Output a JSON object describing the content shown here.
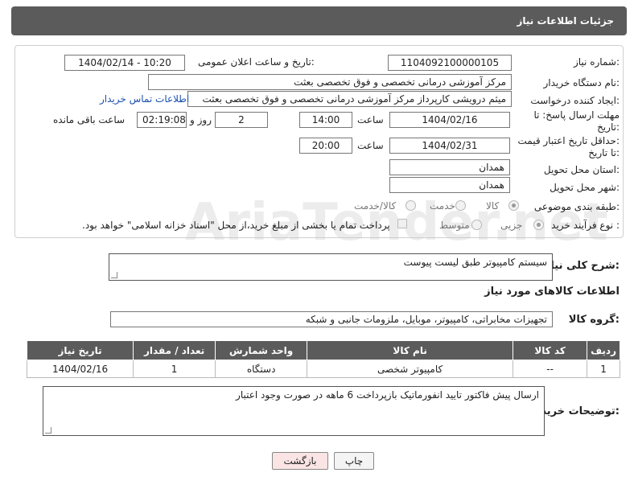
{
  "header": {
    "title": "جزئیات اطلاعات نیاز"
  },
  "fields": {
    "need_number_label": "شماره نیاز:",
    "need_number": "1104092100000105",
    "announce_label": "تاریخ و ساعت اعلان عمومی:",
    "announce_value": "1404/02/14 - 10:20",
    "buyer_org_label": "نام دستگاه خریدار:",
    "buyer_org": "مرکز آموزشی درمانی تخصصی و فوق تخصصی بعثت",
    "creator_label": "ایجاد کننده درخواست:",
    "creator": "میثم درویشی کارپرداز مرکز آموزشی درمانی تخصصی و فوق تخصصی بعثت",
    "contact_link": "اطلاعات تماس خریدار",
    "deadline_label_1": "مهلت ارسال پاسخ: تا",
    "deadline_label_2": "تاریخ:",
    "deadline_date": "1404/02/16",
    "time_label": "ساعت",
    "deadline_time": "14:00",
    "days_value": "2",
    "days_label": "روز و",
    "remaining_time": "02:19:08",
    "remaining_label": "ساعت باقی مانده",
    "min_valid_label_1": "حداقل تاریخ اعتبار قیمت:",
    "min_valid_label_2": "تا تاریخ:",
    "min_valid_date": "1404/02/31",
    "min_valid_time_label": "ساعت",
    "min_valid_time": "20:00",
    "province_label": "استان محل تحویل:",
    "province": "همدان",
    "city_label": "شهر محل تحویل:",
    "city": "همدان",
    "category_label": "طبقه بندی موضوعی:",
    "category_options": [
      "کالا",
      "خدمت",
      "کالا/خدمت"
    ],
    "process_label": "نوع فرآیند خرید :",
    "process_options": [
      "جزیی",
      "متوسط"
    ],
    "payment_note": "پرداخت تمام یا بخشی از مبلغ خرید،از محل \"اسناد خزانه اسلامی\" خواهد بود."
  },
  "description": {
    "label": "شرح کلی نیاز:",
    "value": "سیستم کامپیوتر طبق لیست پیوست"
  },
  "goods_section": {
    "title": "اطلاعات کالاهای مورد نیاز",
    "group_label": "گروه کالا:",
    "group_value": "تجهیزات مخابراتی، کامپیوتر، موبایل، ملزومات جانبی و شبکه"
  },
  "table": {
    "headers": [
      "ردیف",
      "کد کالا",
      "نام کالا",
      "واحد شمارش",
      "تعداد / مقدار",
      "تاریخ نیاز"
    ],
    "rows": [
      [
        "1",
        "--",
        "کامپیوتر شخصی",
        "دستگاه",
        "1",
        "1404/02/16"
      ]
    ]
  },
  "buyer_notes": {
    "label": "توضیحات خریدار:",
    "value": "ارسال پیش فاکتور تایید انفورماتیک بازپرداخت 6 ماهه در صورت وجود اعتبار"
  },
  "buttons": {
    "print": "چاپ",
    "back": "بازگشت"
  },
  "watermark": "AriaTender.net"
}
